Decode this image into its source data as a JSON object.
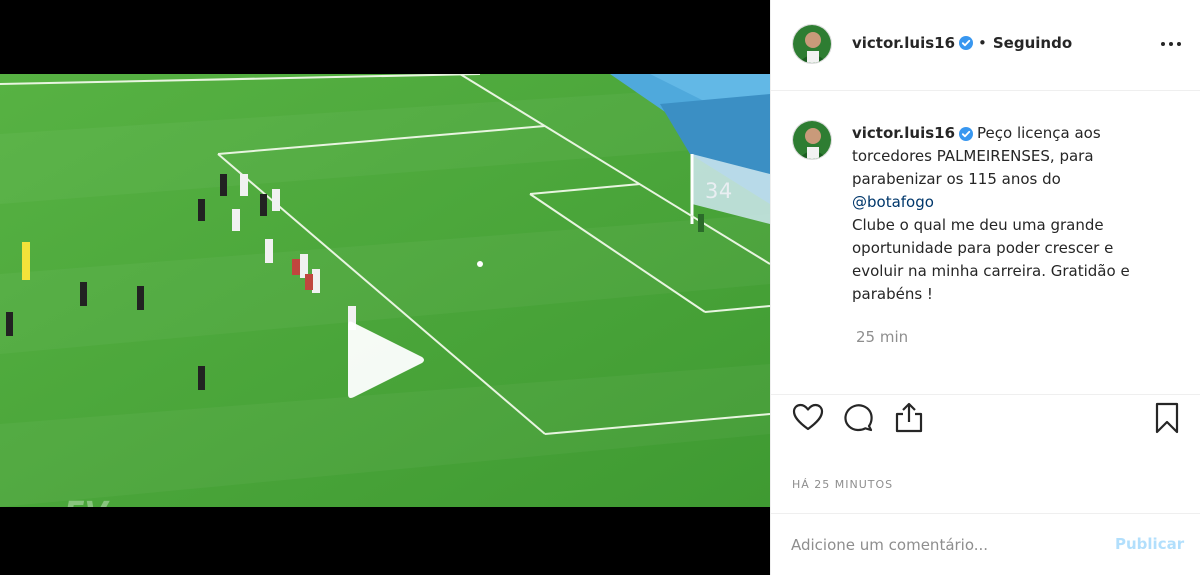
{
  "post": {
    "username": "victor.luis16",
    "verified": true,
    "follow_status": "Seguindo",
    "separator": "•"
  },
  "video": {
    "scoreboard_text": "34",
    "watermark": "FV",
    "play_icon": "play-icon",
    "sound_icon": "speaker-icon"
  },
  "caption": {
    "username": "victor.luis16",
    "text_before_mention": "Peço licença aos torcedores PALMEIRENSES, para parabenizar os 115 anos do",
    "mention": "@botafogo",
    "text_after_mention": "Clube o qual me deu uma grande oportunidade para poder crescer e evoluir na minha carreira. Gratidão e parabéns !",
    "time": "25 min"
  },
  "actions": {
    "like_icon": "heart-icon",
    "comment_icon": "comment-icon",
    "share_icon": "share-icon",
    "save_icon": "bookmark-icon"
  },
  "timestamp": "HÁ 25 MINUTOS",
  "comment": {
    "placeholder": "Adicione um comentário...",
    "value": "",
    "publish_label": "Publicar"
  },
  "colors": {
    "verified_badge": "#3897f0",
    "mention": "#00376b",
    "secondary_text": "#8e8e8e",
    "publish_disabled": "#b2dffc",
    "pitch_green": "#4aa53a"
  }
}
